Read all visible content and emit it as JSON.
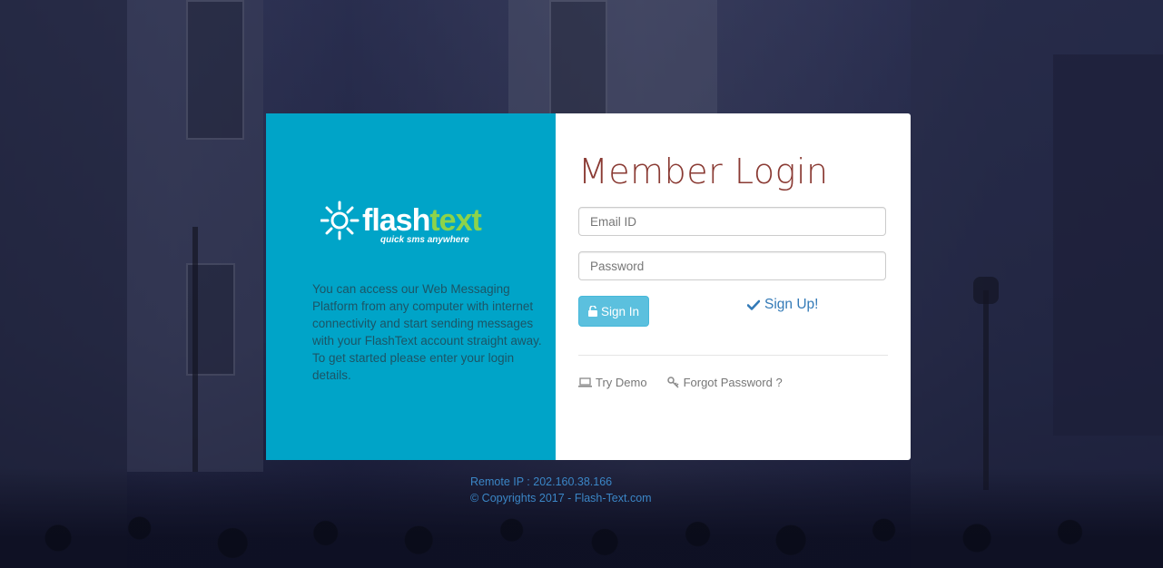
{
  "brand": {
    "logo_word_1": "flash",
    "logo_word_2": "text",
    "tagline": "quick sms anywhere",
    "primary_color": "#00a4c8",
    "accent_color": "#8dd34a"
  },
  "intro_text": "You can access our Web Messaging Platform from any computer with internet connectivity and start sending messages with your FlashText account straight away. To get started please enter your login details.",
  "login": {
    "title": "Member Login",
    "email_placeholder": "Email ID",
    "email_value": "",
    "password_placeholder": "Password",
    "password_value": "",
    "signin_label": "Sign In",
    "signup_label": "Sign Up!",
    "try_demo_label": "Try Demo",
    "forgot_label": "Forgot Password ?"
  },
  "footer": {
    "remote_ip": "Remote IP : 202.160.38.166",
    "copyright": "© Copyrights 2017 - Flash-Text.com"
  },
  "icons": {
    "signin": "unlock-icon",
    "signup": "check-icon",
    "demo": "laptop-icon",
    "forgot": "key-icon"
  }
}
